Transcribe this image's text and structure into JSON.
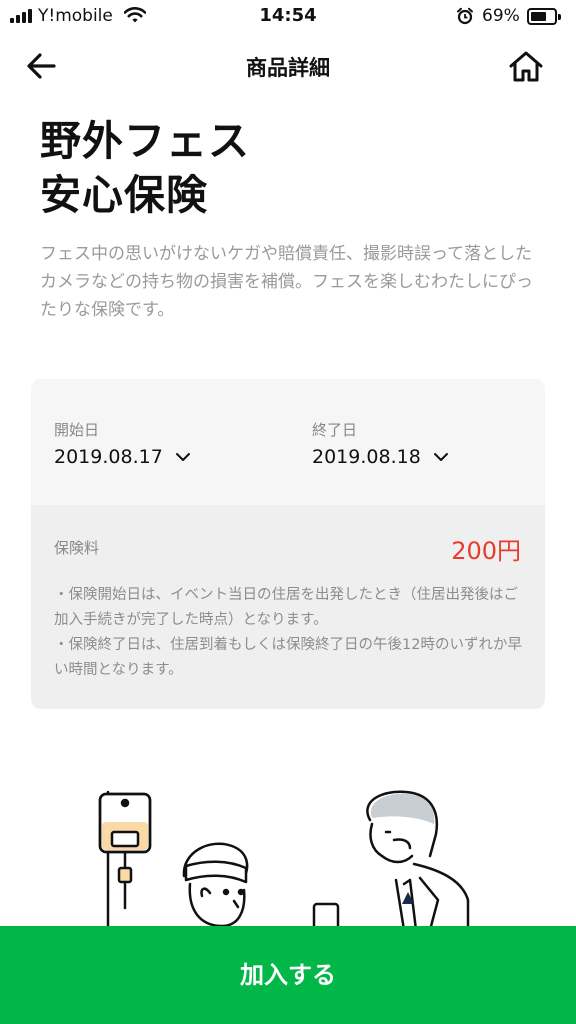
{
  "status_bar": {
    "carrier": "Y!mobile",
    "time": "14:54",
    "battery_percent": "69%",
    "battery_level": 0.69
  },
  "nav": {
    "title": "商品詳細"
  },
  "product": {
    "title_line1": "野外フェス",
    "title_line2": "安心保険",
    "description": "フェス中の思いがけないケガや賠償責任、撮影時誤って落としたカメラなどの持ち物の損害を補償。フェスを楽しむわたしにぴったりな保険です。"
  },
  "coverage": {
    "start_label": "開始日",
    "start_value": "2019.08.17",
    "end_label": "終了日",
    "end_value": "2019.08.18",
    "fee_label": "保険料",
    "fee_value": "200円",
    "fee_color": "#e83b2e",
    "note1": "・保険開始日は、イベント当日の住居を出発したとき（住居出発後はご加入手続きが完了した時点）となります。",
    "note2": "・保険終了日は、住居到着もしくは保険終了日の午後12時のいずれか早い時間となります。"
  },
  "cta": {
    "join_label": "加入する",
    "color": "#00b748"
  }
}
